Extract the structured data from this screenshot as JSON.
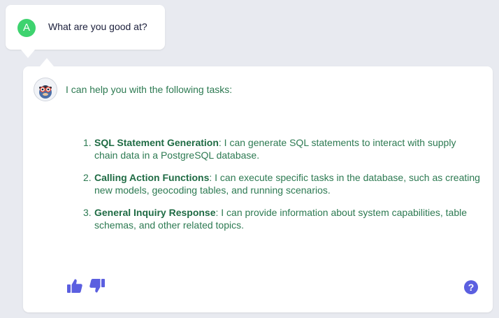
{
  "user_message": {
    "avatar_letter": "A",
    "text": "What are you good at?"
  },
  "assistant_message": {
    "intro": "I can help you with the following tasks:",
    "tasks": [
      {
        "number": "1.",
        "title": "SQL Statement Generation",
        "description": ": I can generate SQL statements to interact with supply chain data in a PostgreSQL database."
      },
      {
        "number": "2.",
        "title": "Calling Action Functions",
        "description": ": I can execute specific tasks in the database, such as creating new models, geocoding tables, and running scenarios."
      },
      {
        "number": "3.",
        "title": "General Inquiry Response",
        "description": ": I can provide information about system capabilities, table schemas, and other related topics."
      }
    ]
  },
  "feedback": {
    "thumbs_up_icon": "thumbs-up-icon",
    "thumbs_down_icon": "thumbs-down-icon"
  },
  "help": {
    "label": "?"
  },
  "colors": {
    "background": "#e8eaf0",
    "user_avatar": "#3ed36f",
    "assistant_text": "#2d7a52",
    "accent": "#5b5fe0"
  }
}
